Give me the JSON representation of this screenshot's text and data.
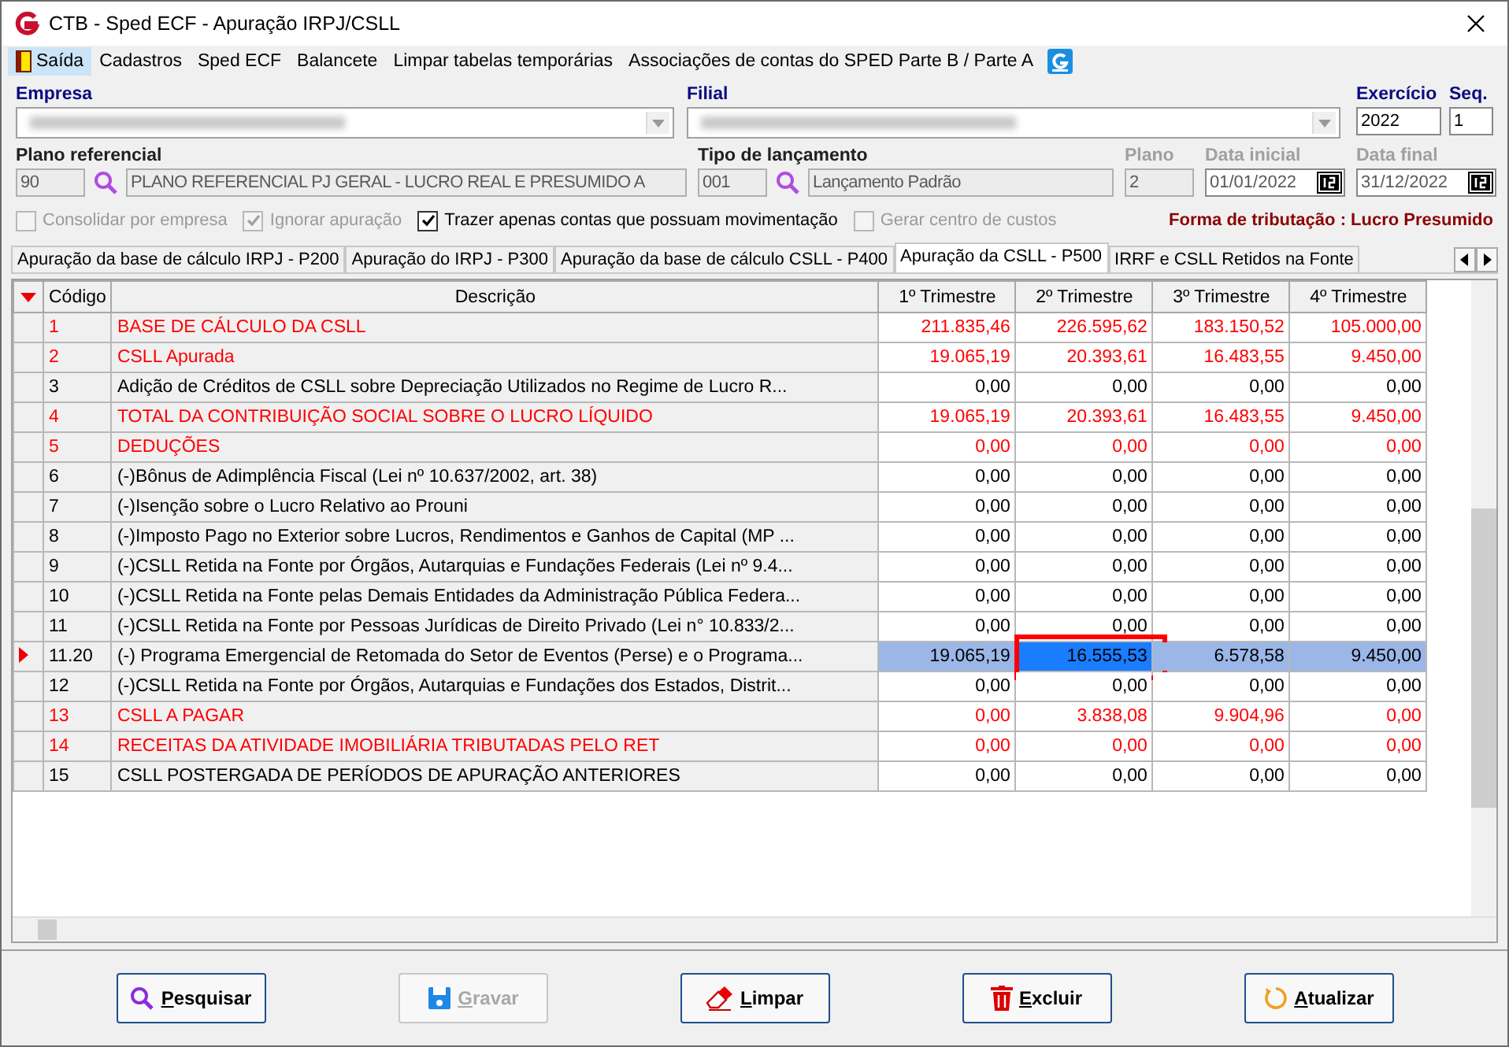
{
  "window": {
    "title": "CTB - Sped ECF - Apuração IRPJ/CSLL"
  },
  "menu": [
    {
      "label": "Saída",
      "selected": true
    },
    {
      "label": "Cadastros",
      "selected": false
    },
    {
      "label": "Sped ECF",
      "selected": false
    },
    {
      "label": "Balancete",
      "selected": false
    },
    {
      "label": "Limpar tabelas temporárias",
      "selected": false
    },
    {
      "label": "Associações de contas do SPED Parte B / Parte A",
      "selected": false
    }
  ],
  "form": {
    "empresa": {
      "label": "Empresa",
      "required": true,
      "label_disabled": false
    },
    "filial": {
      "label": "Filial",
      "required": true,
      "label_disabled": false
    },
    "exercicio": {
      "label": "Exercício",
      "value": "2022",
      "required": true,
      "label_disabled": false
    },
    "seq": {
      "label": "Seq.",
      "value": "1",
      "required": true,
      "label_disabled": false
    },
    "plano_referencial": {
      "label": "Plano referencial",
      "required": false,
      "label_disabled": false,
      "code": "90",
      "description": "PLANO REFERENCIAL PJ GERAL - LUCRO REAL E PRESUMIDO A",
      "disabled": true
    },
    "tipo_lancamento": {
      "label": "Tipo de lançamento",
      "required": false,
      "label_disabled": false,
      "code": "001",
      "description": "Lançamento Padrão",
      "disabled": true
    },
    "plano": {
      "label": "Plano",
      "required": false,
      "label_disabled": true,
      "value": "2",
      "disabled": true
    },
    "data_inicial": {
      "label": "Data inicial",
      "required": false,
      "label_disabled": true,
      "value": "01/01/2022",
      "disabled": true
    },
    "data_final": {
      "label": "Data final",
      "required": false,
      "label_disabled": true,
      "value": "31/12/2022",
      "disabled": true
    }
  },
  "options": [
    {
      "label": "Consolidar por empresa",
      "checked": false,
      "disabled": true
    },
    {
      "label": "Ignorar apuração",
      "checked": true,
      "disabled": true
    },
    {
      "label": "Trazer apenas contas que possuam movimentação",
      "checked": true,
      "disabled": false
    },
    {
      "label": "Gerar centro de custos",
      "checked": false,
      "disabled": true
    }
  ],
  "tributacao": "Forma de tributação : Lucro Presumido",
  "tabs": [
    {
      "label": "Apuração da base de cálculo IRPJ - P200",
      "selected": false
    },
    {
      "label": "Apuração do IRPJ - P300",
      "selected": false
    },
    {
      "label": "Apuração da base de cálculo CSLL - P400",
      "selected": false
    },
    {
      "label": "Apuração da CSLL - P500",
      "selected": true
    },
    {
      "label": "IRRF e CSLL Retidos na Fonte",
      "selected": false
    }
  ],
  "table": {
    "columns": [
      "Código",
      "Descrição",
      "1º Trimestre",
      "2º Trimestre",
      "3º Trimestre",
      "4º Trimestre"
    ],
    "annotation_frame": true,
    "rows": [
      {
        "code": "1",
        "description": "BASE DE CÁLCULO DA CSLL",
        "emphasis": true,
        "selected": false,
        "values": [
          {
            "text": "211.835,46",
            "focused": false
          },
          {
            "text": "226.595,62",
            "focused": false
          },
          {
            "text": "183.150,52",
            "focused": false
          },
          {
            "text": "105.000,00",
            "focused": false
          }
        ]
      },
      {
        "code": "2",
        "description": "CSLL Apurada",
        "emphasis": true,
        "selected": false,
        "values": [
          {
            "text": "19.065,19",
            "focused": false
          },
          {
            "text": "20.393,61",
            "focused": false
          },
          {
            "text": "16.483,55",
            "focused": false
          },
          {
            "text": "9.450,00",
            "focused": false
          }
        ]
      },
      {
        "code": "3",
        "description": "Adição de Créditos de CSLL sobre Depreciação Utilizados no Regime de Lucro R...",
        "emphasis": false,
        "selected": false,
        "values": [
          {
            "text": "0,00",
            "focused": false
          },
          {
            "text": "0,00",
            "focused": false
          },
          {
            "text": "0,00",
            "focused": false
          },
          {
            "text": "0,00",
            "focused": false
          }
        ]
      },
      {
        "code": "4",
        "description": "TOTAL DA CONTRIBUIÇÃO SOCIAL SOBRE O LUCRO LÍQUIDO",
        "emphasis": true,
        "selected": false,
        "values": [
          {
            "text": "19.065,19",
            "focused": false
          },
          {
            "text": "20.393,61",
            "focused": false
          },
          {
            "text": "16.483,55",
            "focused": false
          },
          {
            "text": "9.450,00",
            "focused": false
          }
        ]
      },
      {
        "code": "5",
        "description": "DEDUÇÕES",
        "emphasis": true,
        "selected": false,
        "values": [
          {
            "text": "0,00",
            "focused": false
          },
          {
            "text": "0,00",
            "focused": false
          },
          {
            "text": "0,00",
            "focused": false
          },
          {
            "text": "0,00",
            "focused": false
          }
        ]
      },
      {
        "code": "6",
        "description": "(-)Bônus de Adimplência Fiscal (Lei nº 10.637/2002, art. 38)",
        "emphasis": false,
        "selected": false,
        "values": [
          {
            "text": "0,00",
            "focused": false
          },
          {
            "text": "0,00",
            "focused": false
          },
          {
            "text": "0,00",
            "focused": false
          },
          {
            "text": "0,00",
            "focused": false
          }
        ]
      },
      {
        "code": "7",
        "description": "(-)Isenção sobre o Lucro Relativo ao Prouni",
        "emphasis": false,
        "selected": false,
        "values": [
          {
            "text": "0,00",
            "focused": false
          },
          {
            "text": "0,00",
            "focused": false
          },
          {
            "text": "0,00",
            "focused": false
          },
          {
            "text": "0,00",
            "focused": false
          }
        ]
      },
      {
        "code": "8",
        "description": "(-)Imposto Pago no Exterior sobre Lucros, Rendimentos e Ganhos de Capital (MP ...",
        "emphasis": false,
        "selected": false,
        "values": [
          {
            "text": "0,00",
            "focused": false
          },
          {
            "text": "0,00",
            "focused": false
          },
          {
            "text": "0,00",
            "focused": false
          },
          {
            "text": "0,00",
            "focused": false
          }
        ]
      },
      {
        "code": "9",
        "description": "(-)CSLL Retida na Fonte por Órgãos, Autarquias e Fundações Federais (Lei nº 9.4...",
        "emphasis": false,
        "selected": false,
        "values": [
          {
            "text": "0,00",
            "focused": false
          },
          {
            "text": "0,00",
            "focused": false
          },
          {
            "text": "0,00",
            "focused": false
          },
          {
            "text": "0,00",
            "focused": false
          }
        ]
      },
      {
        "code": "10",
        "description": "(-)CSLL Retida na Fonte pelas Demais Entidades da Administração Pública Federa...",
        "emphasis": false,
        "selected": false,
        "values": [
          {
            "text": "0,00",
            "focused": false
          },
          {
            "text": "0,00",
            "focused": false
          },
          {
            "text": "0,00",
            "focused": false
          },
          {
            "text": "0,00",
            "focused": false
          }
        ]
      },
      {
        "code": "11",
        "description": "(-)CSLL Retida na Fonte por Pessoas Jurídicas de Direito Privado (Lei n° 10.833/2...",
        "emphasis": false,
        "selected": false,
        "values": [
          {
            "text": "0,00",
            "focused": false
          },
          {
            "text": "0,00",
            "focused": false
          },
          {
            "text": "0,00",
            "focused": false
          },
          {
            "text": "0,00",
            "focused": false
          }
        ]
      },
      {
        "code": "11.20",
        "description": "(-) Programa Emergencial de Retomada do Setor de Eventos (Perse) e o Programa...",
        "emphasis": false,
        "selected": true,
        "values": [
          {
            "text": "19.065,19",
            "focused": false
          },
          {
            "text": "16.555,53",
            "focused": true
          },
          {
            "text": "6.578,58",
            "focused": false
          },
          {
            "text": "9.450,00",
            "focused": false
          }
        ]
      },
      {
        "code": "12",
        "description": "(-)CSLL Retida na Fonte por Órgãos, Autarquias e Fundações dos Estados, Distrit...",
        "emphasis": false,
        "selected": false,
        "values": [
          {
            "text": "0,00",
            "focused": false
          },
          {
            "text": "0,00",
            "focused": false
          },
          {
            "text": "0,00",
            "focused": false
          },
          {
            "text": "0,00",
            "focused": false
          }
        ]
      },
      {
        "code": "13",
        "description": "CSLL A PAGAR",
        "emphasis": true,
        "selected": false,
        "values": [
          {
            "text": "0,00",
            "focused": false
          },
          {
            "text": "3.838,08",
            "focused": false
          },
          {
            "text": "9.904,96",
            "focused": false
          },
          {
            "text": "0,00",
            "focused": false
          }
        ]
      },
      {
        "code": "14",
        "description": "RECEITAS DA ATIVIDADE IMOBILIÁRIA TRIBUTADAS PELO RET",
        "emphasis": true,
        "selected": false,
        "values": [
          {
            "text": "0,00",
            "focused": false
          },
          {
            "text": "0,00",
            "focused": false
          },
          {
            "text": "0,00",
            "focused": false
          },
          {
            "text": "0,00",
            "focused": false
          }
        ]
      },
      {
        "code": "15",
        "description": "CSLL POSTERGADA DE PERÍODOS DE APURAÇÃO ANTERIORES",
        "emphasis": false,
        "selected": false,
        "values": [
          {
            "text": "0,00",
            "focused": false
          },
          {
            "text": "0,00",
            "focused": false
          },
          {
            "text": "0,00",
            "focused": false
          },
          {
            "text": "0,00",
            "focused": false
          }
        ]
      }
    ]
  },
  "buttons": [
    {
      "label": "Pesquisar",
      "kind": "search",
      "disabled": false
    },
    {
      "label": "Gravar",
      "kind": "save",
      "disabled": true
    },
    {
      "label": "Limpar",
      "kind": "clear",
      "disabled": false
    },
    {
      "label": "Excluir",
      "kind": "delete",
      "disabled": false
    },
    {
      "label": "Atualizar",
      "kind": "refresh",
      "disabled": false
    }
  ]
}
